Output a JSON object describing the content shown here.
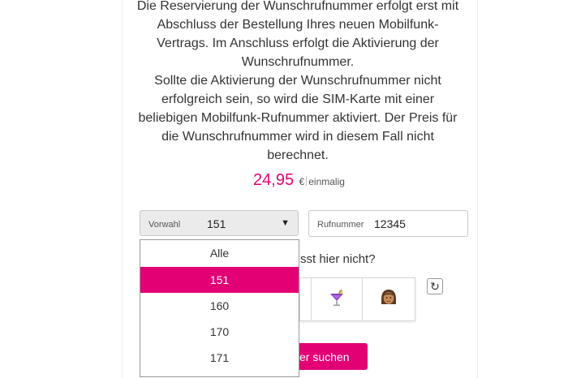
{
  "description": {
    "paragraph1": "Die Reservierung der Wunschrufnummer erfolgt erst mit Abschluss der Bestellung Ihres neuen Mobilfunk-Vertrags. Im Anschluss erfolgt die Aktivierung der Wunschrufnummer.",
    "paragraph2": "Sollte die Aktivierung der Wunschrufnummer nicht erfolgreich sein, so wird die SIM-Karte mit einer beliebigen Mobilfunk-Rufnummer aktiviert. Der Preis für die Wunschrufnummer wird in diesem Fall nicht berechnet."
  },
  "price": {
    "value": "24,95",
    "currency": "€",
    "note": "einmalig"
  },
  "prefix_select": {
    "label": "Vorwahl",
    "value": "151",
    "arrow": "▼"
  },
  "number_field": {
    "label": "Rufnummer",
    "value": "12345"
  },
  "dropdown": {
    "options": [
      "Alle",
      "151",
      "160",
      "170",
      "171"
    ],
    "selected": "151"
  },
  "captcha": {
    "question_fragment": "sst hier nicht?",
    "options": [
      {
        "name": "partial-icon"
      },
      {
        "name": "cocktail-icon"
      },
      {
        "name": "woman-face-icon"
      }
    ],
    "refresh_icon": "↻"
  },
  "search_button": {
    "label": "er suchen"
  },
  "colors": {
    "accent": "#e20074"
  }
}
